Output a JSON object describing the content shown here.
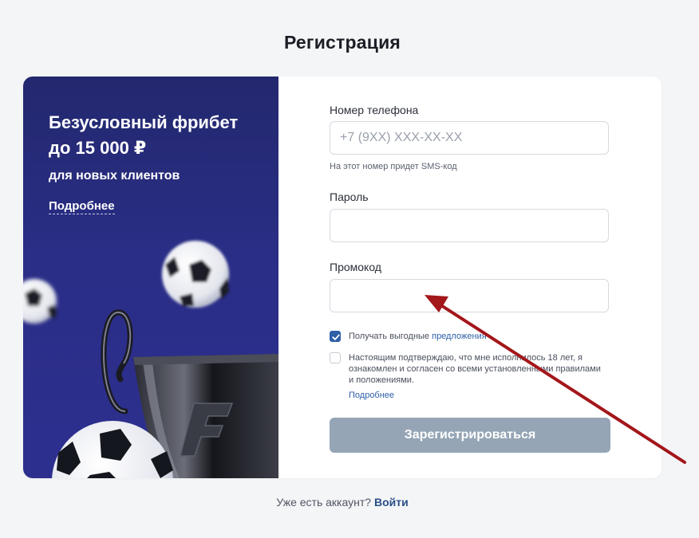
{
  "page": {
    "title": "Регистрация"
  },
  "promo": {
    "title": "Безусловный фрибет до 15 000 ₽",
    "subtitle": "для новых клиентов",
    "more_link": "Подробнее",
    "logo_letter": "F"
  },
  "form": {
    "phone": {
      "label": "Номер телефона",
      "placeholder": "+7 (9XX) XXX-XX-XX",
      "value": "",
      "hint": "На этот номер придет SMS-код"
    },
    "password": {
      "label": "Пароль",
      "value": ""
    },
    "promocode": {
      "label": "Промокод",
      "value": ""
    },
    "offers_checkbox": {
      "checked": true,
      "text_before": "Получать выгодные ",
      "link_text": "предложения"
    },
    "terms_checkbox": {
      "checked": false,
      "text": "Настоящим подтверждаю, что мне исполнилось 18 лет, я ознакомлен и согласен со всеми установленными правилами и положениями.",
      "more_link": "Подробнее"
    },
    "submit_label": "Зарегистрироваться"
  },
  "footer": {
    "question": "Уже есть аккаунт? ",
    "login_link": "Войти"
  },
  "colors": {
    "accent": "#2e5fa8",
    "button_disabled": "#95a5b5",
    "promo_bg": "#2a2e86",
    "arrow": "#a3161a"
  }
}
